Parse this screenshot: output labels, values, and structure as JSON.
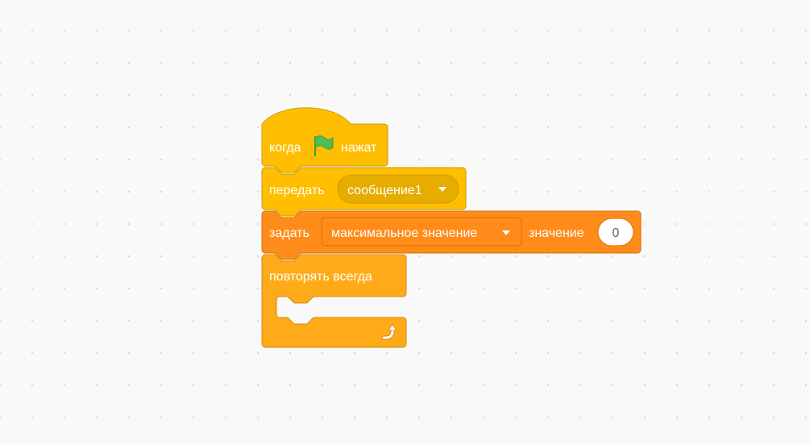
{
  "colors": {
    "events": "#ffbf00",
    "events_border": "#cc9900",
    "events_dropdown": "#e6ac00",
    "variables": "#ff8c1a",
    "variables_border": "#db6e00",
    "control": "#ffab19",
    "control_border": "#cf8b17",
    "text_dark": "#575e75",
    "flag_green": "#4cbf56"
  },
  "script": {
    "hat_block": {
      "label_before": "когда",
      "icon": "green-flag-icon",
      "label_after": "нажат"
    },
    "broadcast_block": {
      "label": "передать",
      "message_value": "сообщение1"
    },
    "set_variable_block": {
      "label": "задать",
      "variable_value": "максимальное значение",
      "value_label": "значение",
      "value_input": "0"
    },
    "forever_block": {
      "label": "повторять всегда",
      "icon": "loop-arrow-icon"
    }
  }
}
